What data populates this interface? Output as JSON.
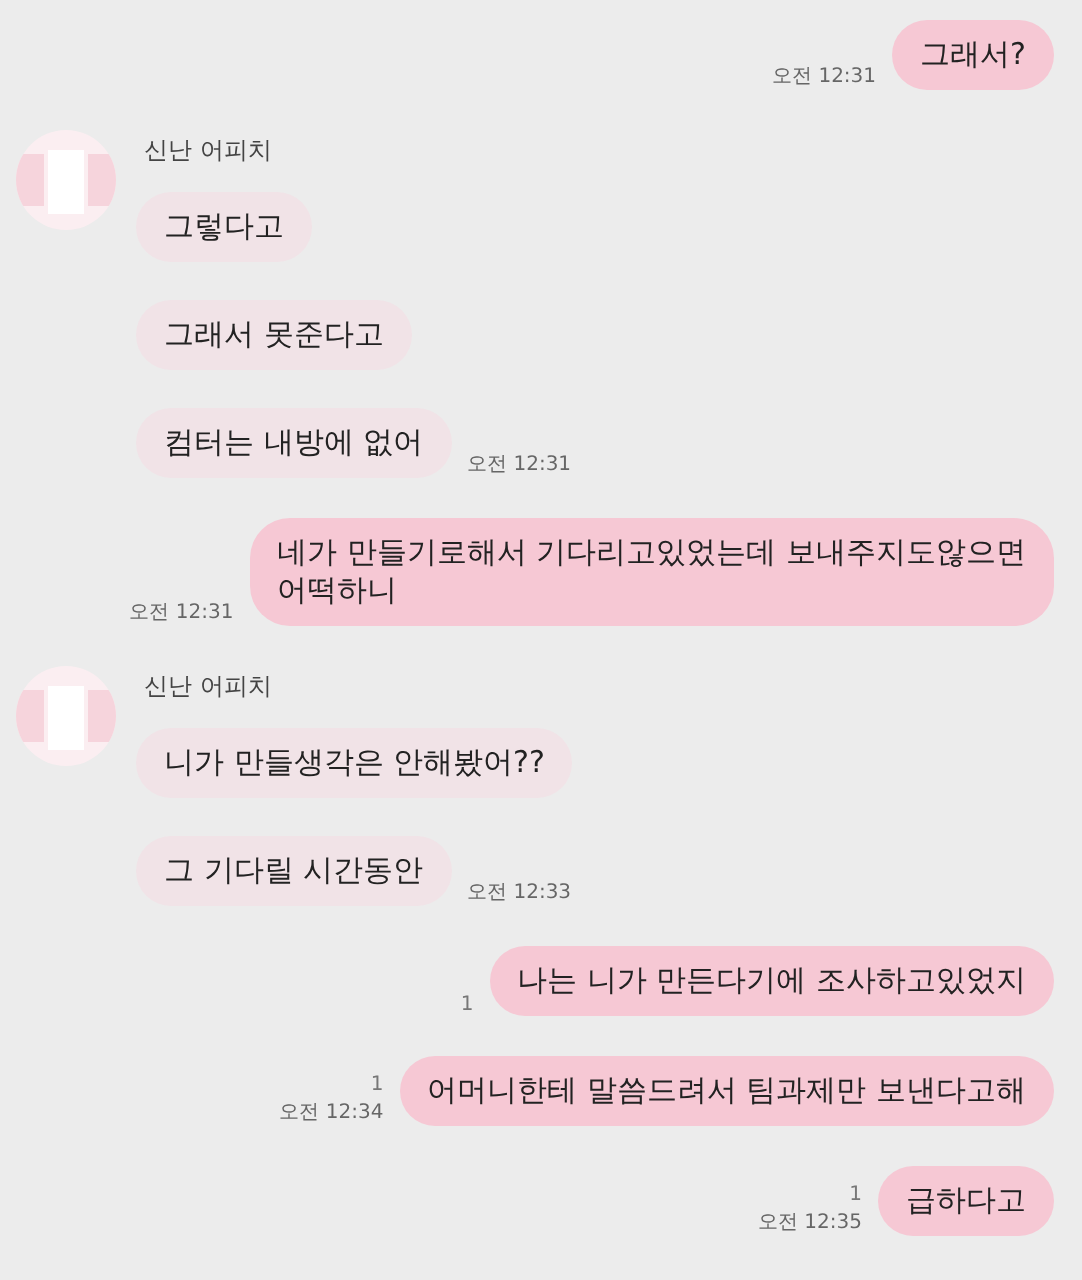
{
  "messages": [
    {
      "kind": "sent",
      "text": "그래서?",
      "time": "오전 12:31"
    },
    {
      "kind": "received",
      "sender": "신난 어피치",
      "bubbles": [
        {
          "text": "그렇다고"
        },
        {
          "text": "그래서 못준다고"
        },
        {
          "text": "컴터는 내방에 없어",
          "time": "오전 12:31"
        }
      ]
    },
    {
      "kind": "sent",
      "text": "네가 만들기로해서 기다리고있었는데 보내주지도않으면\n어떡하니",
      "time": "오전 12:31"
    },
    {
      "kind": "received",
      "sender": "신난 어피치",
      "bubbles": [
        {
          "text": "니가 만들생각은 안해봤어??"
        },
        {
          "text": "그 기다릴 시간동안",
          "time": "오전 12:33"
        }
      ]
    },
    {
      "kind": "sent",
      "text": "나는 니가 만든다기에 조사하고있었지",
      "unread": "1"
    },
    {
      "kind": "sent",
      "text": "어머니한테 말씀드려서 팀과제만 보낸다고해",
      "unread": "1",
      "time": "오전 12:34"
    },
    {
      "kind": "sent",
      "text": "급하다고",
      "unread": "1",
      "time": "오전 12:35"
    }
  ]
}
